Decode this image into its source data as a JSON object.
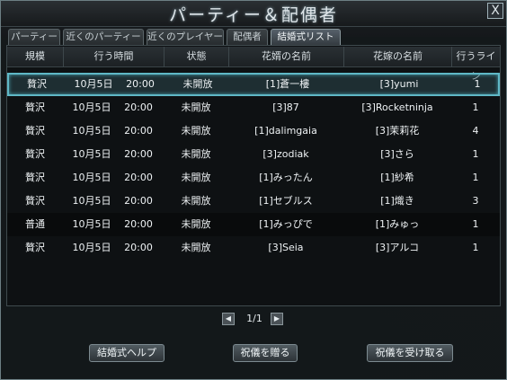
{
  "window": {
    "title": "パーティー＆配偶者",
    "close_label": "X"
  },
  "tabs": [
    {
      "label": "パーティー",
      "active": false
    },
    {
      "label": "近くのパーティー",
      "active": false
    },
    {
      "label": "近くのプレイヤー",
      "active": false
    },
    {
      "label": "配偶者",
      "active": false
    },
    {
      "label": "結婚式リスト",
      "active": true
    }
  ],
  "table": {
    "headers": [
      "規模",
      "行う時間",
      "状態",
      "花婿の名前",
      "花嫁の名前",
      "行うライン"
    ],
    "rows": [
      [
        "贅沢",
        "10月5日",
        "20:00",
        "未開放",
        "[1]蒼一樓",
        "[3]yumi",
        "1"
      ],
      [
        "贅沢",
        "10月5日",
        "20:00",
        "未開放",
        "[3]87",
        "[3]Rocketninja",
        "1"
      ],
      [
        "贅沢",
        "10月5日",
        "20:00",
        "未開放",
        "[1]dalimgaia",
        "[3]茉莉花",
        "4"
      ],
      [
        "贅沢",
        "10月5日",
        "20:00",
        "未開放",
        "[3]zodiak",
        "[3]さら",
        "1"
      ],
      [
        "贅沢",
        "10月5日",
        "20:00",
        "未開放",
        "[1]みったん",
        "[1]紗希",
        "1"
      ],
      [
        "贅沢",
        "10月5日",
        "20:00",
        "未開放",
        "[1]セブルス",
        "[1]熾き",
        "3"
      ],
      [
        "普通",
        "10月5日",
        "20:00",
        "未開放",
        "[1]みっぴで",
        "[1]みゅっ",
        "1"
      ],
      [
        "贅沢",
        "10月5日",
        "20:00",
        "未開放",
        "[3]Seia",
        "[3]アルコ",
        "1"
      ]
    ],
    "selected_row": 0
  },
  "pager": {
    "prev_icon": "◀",
    "next_icon": "▶",
    "page": "1/1"
  },
  "buttons": {
    "help": "結婚式ヘルプ",
    "give": "祝儀を贈る",
    "receive": "祝儀を受け取る"
  },
  "colors": {
    "accent": "#5fb8c6",
    "bg": "#0e1113"
  }
}
